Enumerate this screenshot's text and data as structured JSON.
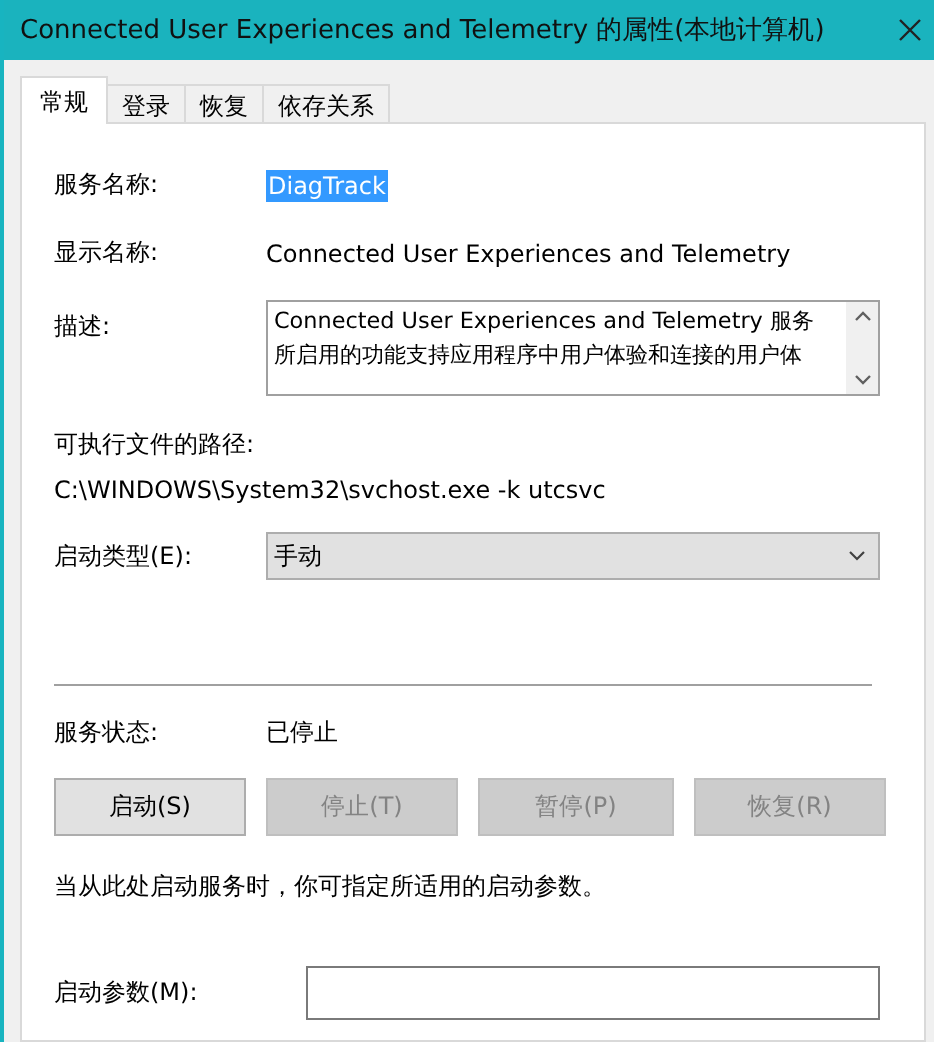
{
  "window": {
    "title": "Connected User Experiences and Telemetry 的属性(本地计算机)"
  },
  "tabs": [
    {
      "label": "常规",
      "selected": true
    },
    {
      "label": "登录",
      "selected": false
    },
    {
      "label": "恢复",
      "selected": false
    },
    {
      "label": "依存关系",
      "selected": false
    }
  ],
  "service_name": {
    "label": "服务名称:",
    "value": "DiagTrack",
    "selected": true
  },
  "display_name": {
    "label": "显示名称:",
    "value": "Connected User Experiences and Telemetry"
  },
  "description": {
    "label": "描述:",
    "lines": [
      "Connected User Experiences and Telemetry 服务",
      "所启用的功能支持应用程序中用户体验和连接的用户体"
    ]
  },
  "path": {
    "label": "可执行文件的路径:",
    "value": "C:\\WINDOWS\\System32\\svchost.exe -k utcsvc"
  },
  "startup_type": {
    "label": "启动类型(E):",
    "value": "手动"
  },
  "service_status": {
    "label": "服务状态:",
    "value": "已停止"
  },
  "buttons": [
    {
      "label": "启动(S)",
      "disabled": false
    },
    {
      "label": "停止(T)",
      "disabled": true
    },
    {
      "label": "暂停(P)",
      "disabled": true
    },
    {
      "label": "恢复(R)",
      "disabled": true
    }
  ],
  "hint": "当从此处启动服务时，你可指定所适用的启动参数。",
  "start_params": {
    "label": "启动参数(M):"
  }
}
